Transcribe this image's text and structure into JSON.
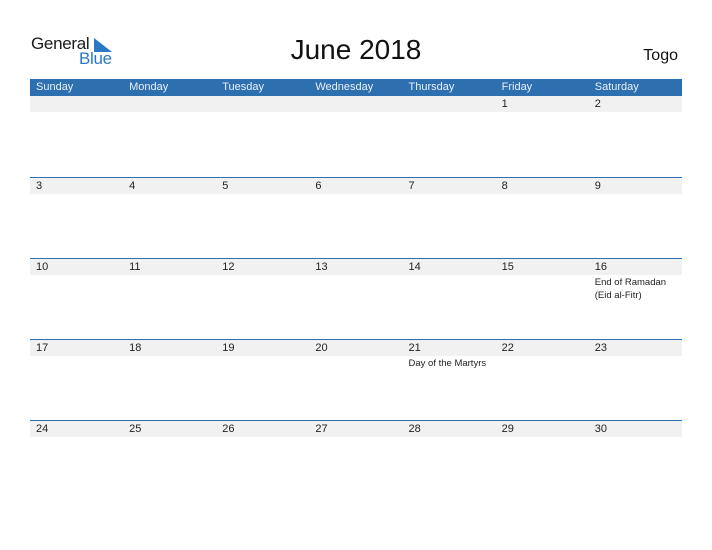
{
  "logo": {
    "line1": "General",
    "line2": "Blue"
  },
  "title": "June 2018",
  "country": "Togo",
  "colors": {
    "header_bg": "#2e6fb0",
    "date_strip": "#f1f1f1",
    "logo_blue": "#2b79c2"
  },
  "weekdays": [
    "Sunday",
    "Monday",
    "Tuesday",
    "Wednesday",
    "Thursday",
    "Friday",
    "Saturday"
  ],
  "weeks": [
    [
      {
        "d": ""
      },
      {
        "d": ""
      },
      {
        "d": ""
      },
      {
        "d": ""
      },
      {
        "d": ""
      },
      {
        "d": "1"
      },
      {
        "d": "2"
      }
    ],
    [
      {
        "d": "3"
      },
      {
        "d": "4"
      },
      {
        "d": "5"
      },
      {
        "d": "6"
      },
      {
        "d": "7"
      },
      {
        "d": "8"
      },
      {
        "d": "9"
      }
    ],
    [
      {
        "d": "10"
      },
      {
        "d": "11"
      },
      {
        "d": "12"
      },
      {
        "d": "13"
      },
      {
        "d": "14"
      },
      {
        "d": "15"
      },
      {
        "d": "16",
        "ev": [
          "End of Ramadan",
          "(Eid al-Fitr)"
        ]
      }
    ],
    [
      {
        "d": "17"
      },
      {
        "d": "18"
      },
      {
        "d": "19"
      },
      {
        "d": "20"
      },
      {
        "d": "21",
        "ev": [
          "Day of the Martyrs"
        ]
      },
      {
        "d": "22"
      },
      {
        "d": "23"
      }
    ],
    [
      {
        "d": "24"
      },
      {
        "d": "25"
      },
      {
        "d": "26"
      },
      {
        "d": "27"
      },
      {
        "d": "28"
      },
      {
        "d": "29"
      },
      {
        "d": "30"
      }
    ]
  ]
}
